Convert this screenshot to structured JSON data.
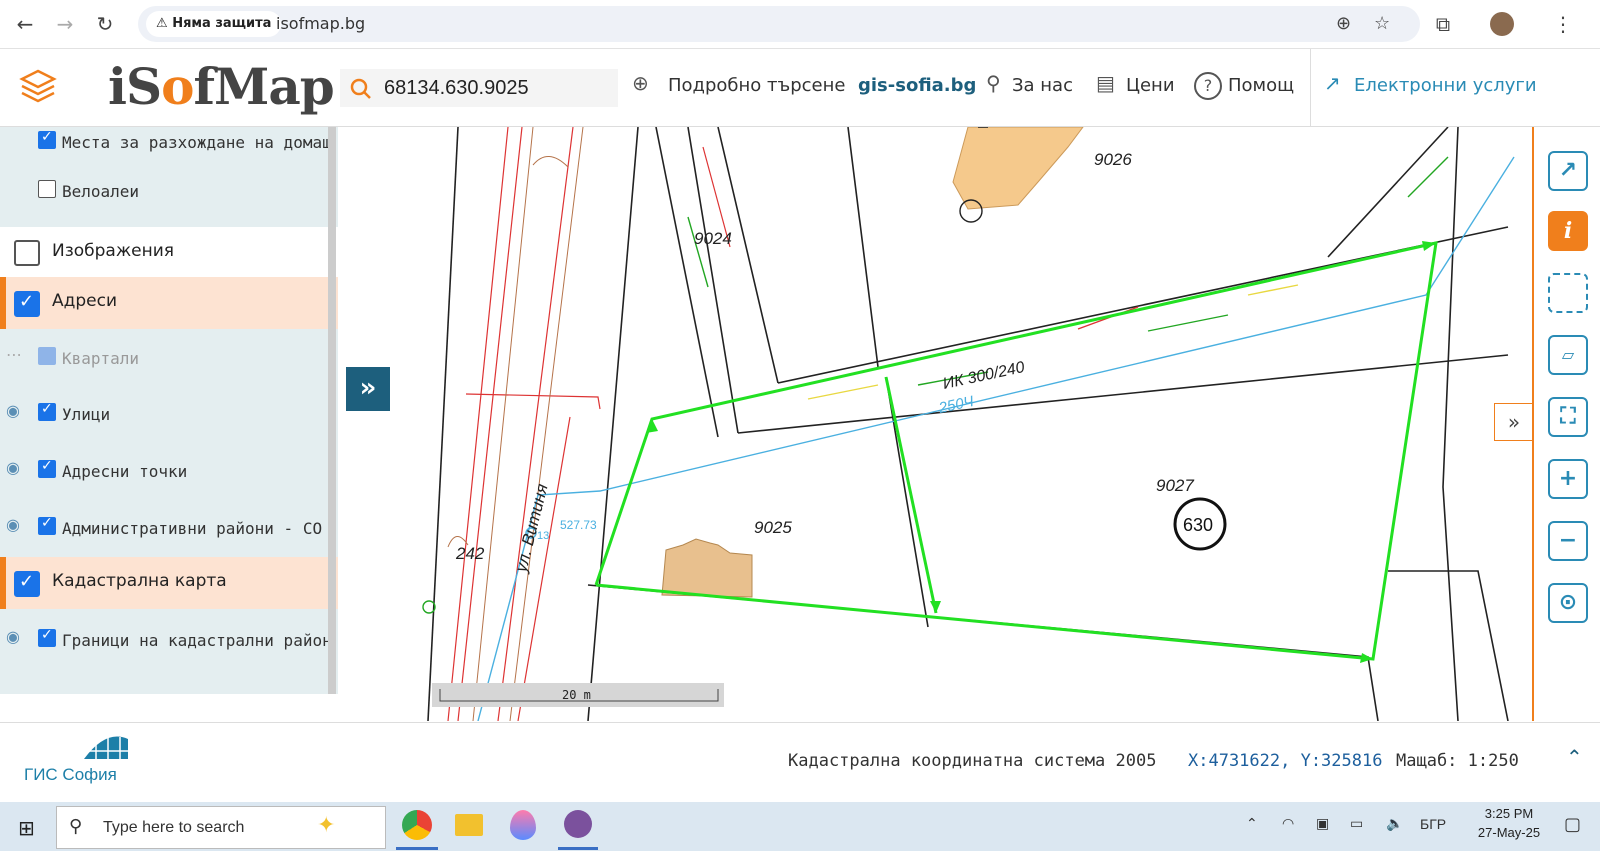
{
  "browser": {
    "security_label": "Няма защита",
    "url": "isofmap.bg"
  },
  "header": {
    "logo_text_pre": "iS",
    "logo_text_o": "o",
    "logo_text_post": "fMap",
    "search_value": "68134.630.9025",
    "advanced_search": "Подробно търсене",
    "gis_link": "gis-sofia.bg",
    "about": "За нас",
    "prices": "Цени",
    "help": "Помощ",
    "eservices": "Електронни услуги"
  },
  "layers": {
    "item_places": "Места за разхождане на домаш",
    "item_bikes": "Велоалеи",
    "group_images": "Изображения",
    "group_addresses": "Адреси",
    "item_quarters": "Квартали",
    "item_streets": "Улици",
    "item_address_points": "Адресни точки",
    "item_admin_districts": "Административни райони - СО",
    "group_cadastral": "Кадастрална карта",
    "item_cadastral_borders": "Граници на кадастрални район"
  },
  "map": {
    "labels": {
      "p9026": "9026",
      "p9024": "9024",
      "p9025": "9025",
      "p9027": "9027",
      "p630": "630",
      "p242": "242",
      "street": "ул. Витиня",
      "pipe_ik": "ИК 300/240",
      "pipe_250": "250Ч",
      "elev": "527.73",
      "n13": "13"
    },
    "scale_bar": "20 m"
  },
  "footer": {
    "org_name": "ГИС София",
    "coord_system": "Кадастрална координатна система 2005",
    "coords": "X:4731622, Y:325816",
    "scale": "Мащаб: 1:250"
  },
  "taskbar": {
    "search_placeholder": "Type here to search",
    "lang": "БГР",
    "time": "3:25 PM",
    "date": "27-May-25"
  },
  "colors": {
    "accent_orange": "#f07f1c",
    "teal": "#1d5f7d",
    "parcel_outline": "#22e022",
    "highlight_row": "#fde3d2"
  }
}
